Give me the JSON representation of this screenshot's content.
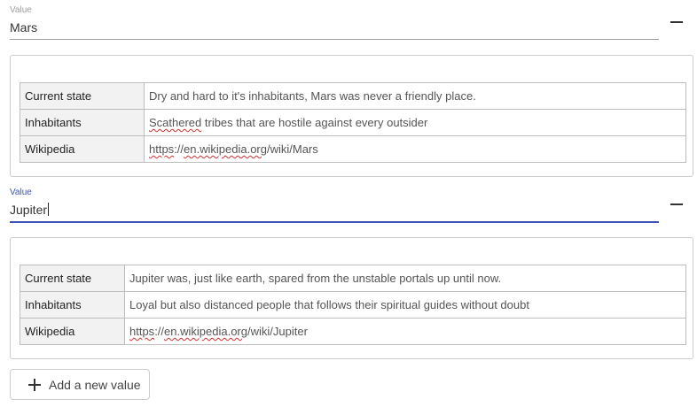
{
  "entries": [
    {
      "field_label": "Value",
      "value": "Mars",
      "rows": [
        {
          "key": "Current state",
          "value": "Dry and hard to it's inhabitants, Mars was never a friendly place."
        },
        {
          "key": "Inhabitants",
          "value_misspelled": "Scathered",
          "value_rest": " tribes that are hostile against every outsider"
        },
        {
          "key": "Wikipedia",
          "link_a": "https",
          "link_b": "://",
          "link_c": "en.wikipedia.org",
          "link_d": "/wiki/Mars"
        }
      ]
    },
    {
      "field_label": "Value",
      "value": "Jupiter",
      "focused": true,
      "rows": [
        {
          "key": "Current state",
          "value": "Jupiter was, just like earth, spared from the unstable portals up until now."
        },
        {
          "key": "Inhabitants",
          "value": "Loyal but also distanced people that follows their spiritual guides without doubt"
        },
        {
          "key": "Wikipedia",
          "link_a": "https",
          "link_b": "://",
          "link_c": "en.wikipedia.org",
          "link_d": "/wiki/Jupiter"
        }
      ]
    }
  ],
  "add_button": {
    "label": "Add a new value",
    "icon": "plus-icon"
  },
  "remove_icon": "minus-icon",
  "colors": {
    "focus": "#3f51b5",
    "border": "#cccccc",
    "key_bg": "#f2f2f2",
    "spellcheck": "#d32f2f"
  }
}
